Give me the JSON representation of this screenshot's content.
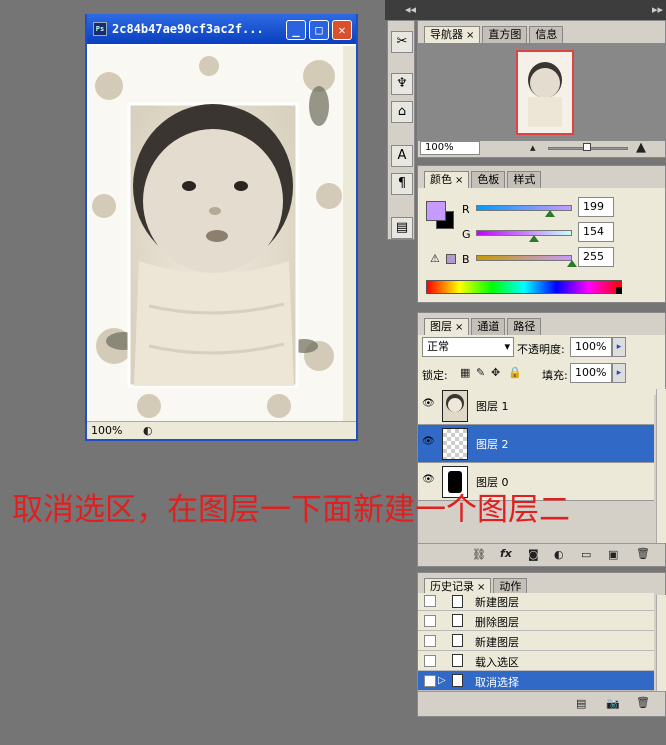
{
  "document": {
    "title": "2c84b47ae90cf3ac2f...",
    "zoom": "100%"
  },
  "navigator": {
    "tabs": [
      "导航器",
      "直方图",
      "信息"
    ],
    "zoom": "100%"
  },
  "color": {
    "tabs": [
      "颜色",
      "色板",
      "样式"
    ],
    "r_label": "R",
    "g_label": "G",
    "b_label": "B",
    "r": "199",
    "g": "154",
    "b": "255",
    "foreground": "#c79aff"
  },
  "layers": {
    "tabs": [
      "图层",
      "通道",
      "路径"
    ],
    "blend_mode": "正常",
    "opacity_label": "不透明度:",
    "opacity": "100%",
    "lock_label": "锁定:",
    "fill_label": "填充:",
    "fill": "100%",
    "items": [
      {
        "name": "图层 1",
        "selected": false
      },
      {
        "name": "图层 2",
        "selected": true
      },
      {
        "name": "图层 0",
        "selected": false
      }
    ]
  },
  "history": {
    "tabs": [
      "历史记录",
      "动作"
    ],
    "items": [
      "新建图层",
      "删除图层",
      "新建图层",
      "载入选区",
      "取消选择"
    ]
  },
  "annotation": "取消选区，在图层一下面新建一个图层二",
  "selection_color": "#3169c6"
}
